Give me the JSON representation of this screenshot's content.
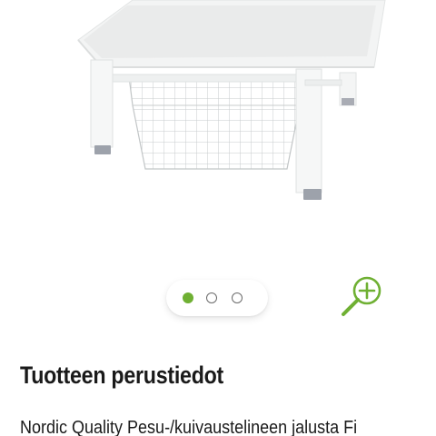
{
  "colors": {
    "accent": "#6fb033",
    "text": "#1a1a1a"
  },
  "gallery": {
    "image_subject": "white-laundry-stand-with-wire-basket",
    "slide_count": 3,
    "active_slide": 1,
    "zoom_icon": "zoom-in-icon"
  },
  "section": {
    "title": "Tuotteen perustiedot"
  },
  "description": {
    "text": "Nordic Quality Pesu-/kuivaustelineen jalusta Fi"
  }
}
